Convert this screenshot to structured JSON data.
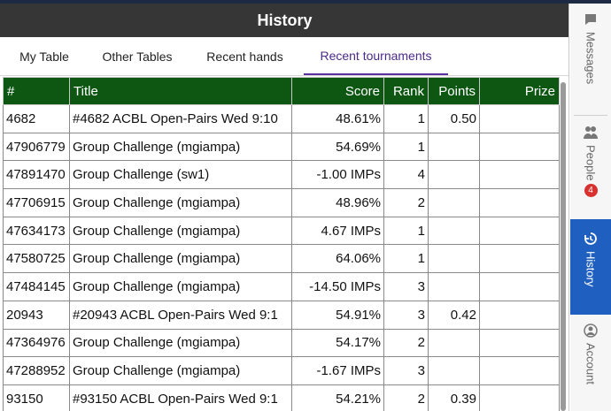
{
  "title": "History",
  "tabs": [
    "My Table",
    "Other Tables",
    "Recent hands",
    "Recent tournaments"
  ],
  "columns": [
    "#",
    "Title",
    "Score",
    "Rank",
    "Points",
    "Prize"
  ],
  "rows": [
    {
      "id": "4682",
      "title": "#4682 ACBL Open-Pairs Wed 9:10",
      "score": "48.61%",
      "rank": "1",
      "points": "0.50",
      "prize": ""
    },
    {
      "id": "47906779",
      "title": "Group Challenge (mgiampa)",
      "score": "54.69%",
      "rank": "1",
      "points": "",
      "prize": ""
    },
    {
      "id": "47891470",
      "title": "Group Challenge (sw1)",
      "score": "-1.00 IMPs",
      "rank": "4",
      "points": "",
      "prize": ""
    },
    {
      "id": "47706915",
      "title": "Group Challenge (mgiampa)",
      "score": "48.96%",
      "rank": "2",
      "points": "",
      "prize": ""
    },
    {
      "id": "47634173",
      "title": "Group Challenge (mgiampa)",
      "score": "4.67 IMPs",
      "rank": "1",
      "points": "",
      "prize": ""
    },
    {
      "id": "47580725",
      "title": "Group Challenge (mgiampa)",
      "score": "64.06%",
      "rank": "1",
      "points": "",
      "prize": ""
    },
    {
      "id": "47484145",
      "title": "Group Challenge (mgiampa)",
      "score": "-14.50 IMPs",
      "rank": "3",
      "points": "",
      "prize": ""
    },
    {
      "id": "20943",
      "title": "#20943 ACBL Open-Pairs Wed 9:1",
      "score": "54.91%",
      "rank": "3",
      "points": "0.42",
      "prize": ""
    },
    {
      "id": "47364976",
      "title": "Group Challenge (mgiampa)",
      "score": "54.17%",
      "rank": "2",
      "points": "",
      "prize": ""
    },
    {
      "id": "47288952",
      "title": "Group Challenge (mgiampa)",
      "score": "-1.67 IMPs",
      "rank": "3",
      "points": "",
      "prize": ""
    },
    {
      "id": "93150",
      "title": "#93150 ACBL Open-Pairs Wed 9:1",
      "score": "54.21%",
      "rank": "2",
      "points": "0.39",
      "prize": ""
    }
  ],
  "sidebar": {
    "messages": "Messages",
    "people": "People",
    "people_badge": "4",
    "history": "History",
    "account": "Account"
  },
  "colors": {
    "titlebar": "#363636",
    "header": "#0e5713",
    "active_tab": "#5a2fa0",
    "sidebar_active": "#1f5fbf",
    "badge": "#d93030"
  }
}
